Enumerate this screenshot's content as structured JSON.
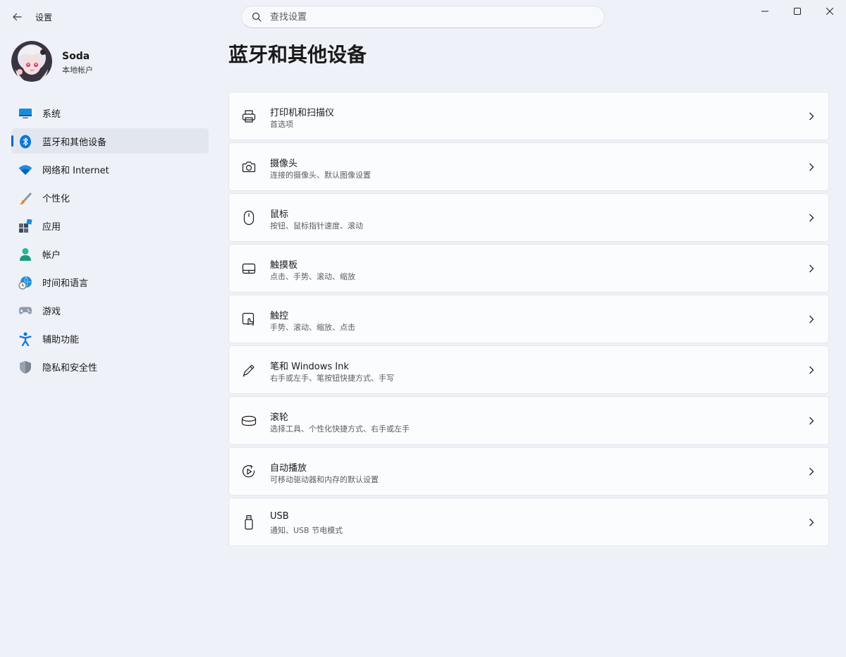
{
  "app": {
    "title": "设置"
  },
  "search": {
    "placeholder": "查找设置"
  },
  "user": {
    "name": "Soda",
    "account_type": "本地帐户"
  },
  "page": {
    "title": "蓝牙和其他设备"
  },
  "accent": "#0067c0",
  "sidebar": {
    "items": [
      {
        "label": "系统",
        "icon": "system-monitor-icon"
      },
      {
        "label": "蓝牙和其他设备",
        "icon": "bluetooth-icon",
        "active": true
      },
      {
        "label": "网络和 Internet",
        "icon": "wifi-icon"
      },
      {
        "label": "个性化",
        "icon": "brush-icon"
      },
      {
        "label": "应用",
        "icon": "apps-icon"
      },
      {
        "label": "帐户",
        "icon": "person-icon"
      },
      {
        "label": "时间和语言",
        "icon": "globe-clock-icon"
      },
      {
        "label": "游戏",
        "icon": "gamepad-icon"
      },
      {
        "label": "辅助功能",
        "icon": "accessibility-icon"
      },
      {
        "label": "隐私和安全性",
        "icon": "shield-icon"
      }
    ]
  },
  "devices": [
    {
      "title": "打印机和扫描仪",
      "subtitle": "首选项",
      "icon": "printer-icon"
    },
    {
      "title": "摄像头",
      "subtitle": "连接的摄像头、默认图像设置",
      "icon": "camera-icon"
    },
    {
      "title": "鼠标",
      "subtitle": "按钮、鼠标指针速度、滚动",
      "icon": "mouse-icon"
    },
    {
      "title": "触摸板",
      "subtitle": "点击、手势、滚动、缩放",
      "icon": "touchpad-icon"
    },
    {
      "title": "触控",
      "subtitle": "手势、滚动、缩放、点击",
      "icon": "touch-icon"
    },
    {
      "title": "笔和 Windows Ink",
      "subtitle": "右手或左手、笔按钮快捷方式、手写",
      "icon": "pen-icon"
    },
    {
      "title": "滚轮",
      "subtitle": "选择工具、个性化快捷方式、右手或左手",
      "icon": "dial-icon"
    },
    {
      "title": "自动播放",
      "subtitle": "可移动驱动器和内存的默认设置",
      "icon": "autoplay-icon"
    },
    {
      "title": "USB",
      "subtitle": "通知、USB 节电模式",
      "icon": "usb-icon"
    }
  ]
}
